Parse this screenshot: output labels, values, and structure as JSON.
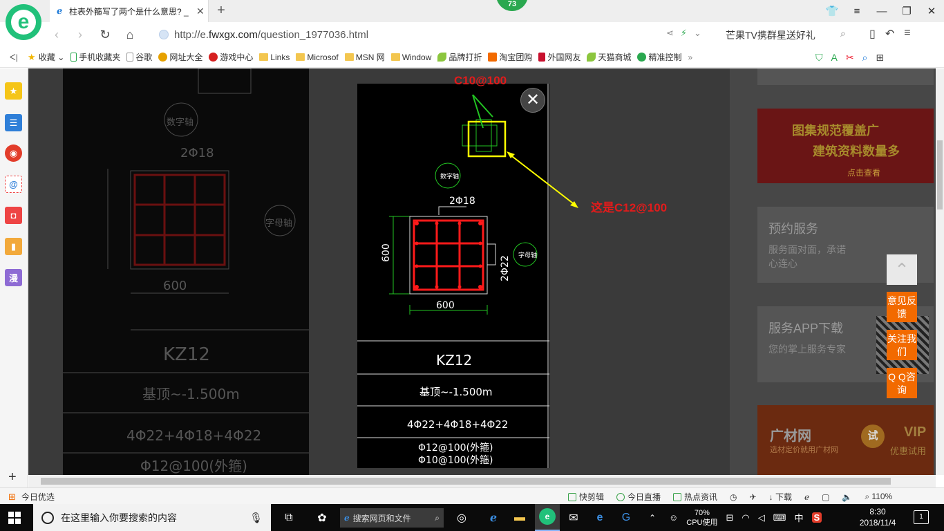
{
  "browser": {
    "tab_title": "柱表外箍写了两个是什么意思? _",
    "badge": "73",
    "url_prefix": "http://e.",
    "url_domain": "fwxgx.com",
    "url_path": "/question_1977036.html",
    "search_hint": "芒果TV携群星送好礼"
  },
  "bookmarks": [
    {
      "label": "收藏",
      "type": "star"
    },
    {
      "label": "手机收藏夹",
      "type": "phone"
    },
    {
      "label": "谷歌",
      "type": "page"
    },
    {
      "label": "网址大全",
      "type": "globe"
    },
    {
      "label": "游戏中心",
      "type": "game"
    },
    {
      "label": "Links",
      "type": "folder"
    },
    {
      "label": "Microsof",
      "type": "folder"
    },
    {
      "label": "MSN 网",
      "type": "folder"
    },
    {
      "label": "Window",
      "type": "folder"
    },
    {
      "label": "品牌打折",
      "type": "leaf"
    },
    {
      "label": "淘宝团购",
      "type": "taobao"
    },
    {
      "label": "外国网友",
      "type": "page-red"
    },
    {
      "label": "天猫商城",
      "type": "leaf"
    },
    {
      "label": "精准控制",
      "type": "wechat"
    }
  ],
  "cad": {
    "axis_label": "数字轴",
    "axis_label2": "字母轴",
    "top_bars": "2Φ18",
    "side_bars": "2Φ22",
    "dim_h": "600",
    "dim_v": "600",
    "column_id": "KZ12",
    "elevation": "基顶~-1.500m",
    "main_bars": "4Φ22+4Φ18+4Φ22",
    "stirrup_outer": "Φ12@100(外箍)",
    "stirrup_inner": "Φ10@100(外箍)"
  },
  "annotations": {
    "c10": "C10@100",
    "c12": "这是C12@100"
  },
  "sidebar_right": {
    "promo1_line1": "图集规范覆盖广",
    "promo1_line2": "建筑资料数量多",
    "promo1_cta": "点击查看",
    "svc1_title": "预约服务",
    "svc1_desc": "服务面对面，承诺心连心",
    "svc2_title": "服务APP下载",
    "svc2_desc": "您的掌上服务专家",
    "promo2_brand": "广材网",
    "promo2_slogan": "选材定价就用广材网",
    "promo2_try": "试",
    "promo2_vip": "VIP",
    "promo2_vip_sub": "优惠试用"
  },
  "float_buttons": {
    "feedback": "意见反馈",
    "follow": "关注我们",
    "qq": "Q Q咨询"
  },
  "statusbar": {
    "left": "今日优选",
    "kuaijianji": "快剪辑",
    "live": "今日直播",
    "news": "热点资讯",
    "download": "下载",
    "zoom": "110%"
  },
  "taskbar": {
    "search_placeholder": "在这里输入你要搜索的内容",
    "mini_search": "搜索网页和文件",
    "cpu_value": "70%",
    "cpu_label": "CPU使用",
    "ime": "中",
    "time": "8:30",
    "date": "2018/11/4",
    "notif_count": "1"
  },
  "colors": {
    "accent_green": "#21c17a",
    "float_orange": "#f26a00",
    "annot_red": "#e21b1b",
    "cad_rebar_red": "#ff1a1a",
    "cad_green": "#22c422",
    "highlight_yellow": "#ffff00"
  }
}
